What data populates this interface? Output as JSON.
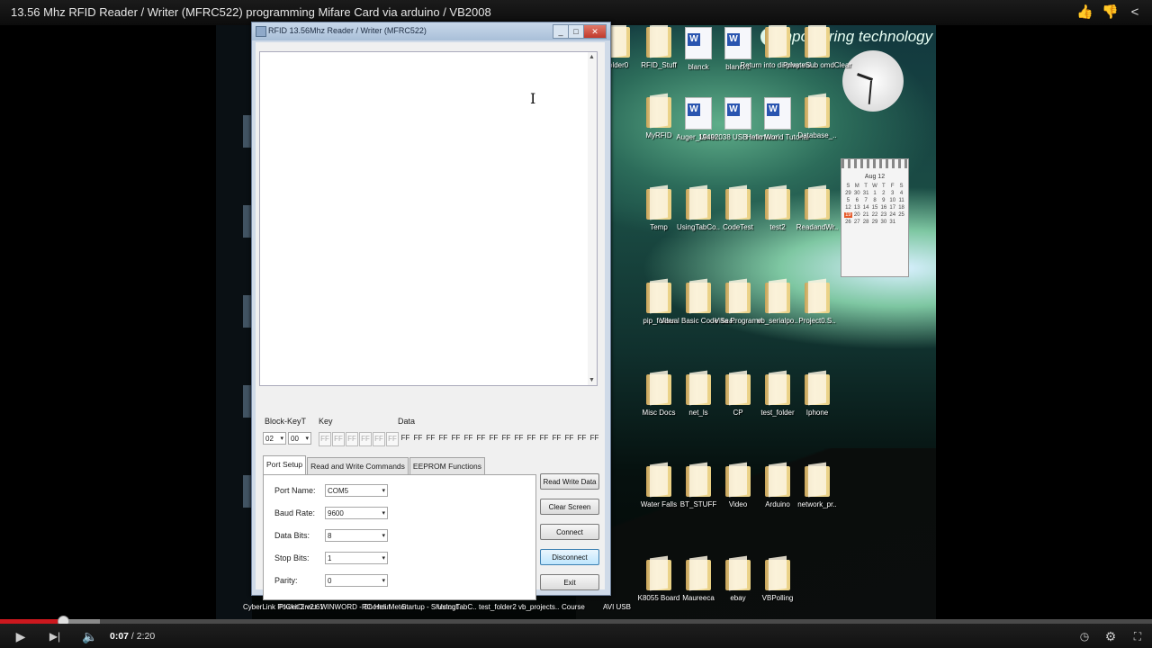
{
  "video": {
    "title": "13.56 Mhz RFID Reader / Writer (MFRC522) programming Mifare Card via arduino / VB2008",
    "current_time": "0:07",
    "duration": "2:20",
    "separator": " / ",
    "progress_fraction": 0.055,
    "buffered_fraction": 0.087
  },
  "icons": {
    "like": "thumbs-up-icon",
    "dislike": "thumbs-down-icon",
    "share": "share-icon",
    "play": "play-icon",
    "next": "next-icon",
    "volume": "volume-icon",
    "watch_later": "clock-icon",
    "settings": "gear-icon",
    "fullscreen": "fullscreen-icon"
  },
  "desktop": {
    "brand_letter": "e",
    "brand_text": "mpowering technology",
    "calendar_month": "Aug 12",
    "calendar_weekdays": [
      "S",
      "M",
      "T",
      "W",
      "T",
      "F",
      "S"
    ],
    "icons_row1": [
      "folder0",
      "RFID_Stuff",
      "blanck",
      "blanck1",
      "Return into display val..",
      "PrivateSub omdClear"
    ],
    "icons_row2": [
      "MyRFID",
      "Auger_Mixer..",
      "19492038 USB Interface",
      "Hello World Tutorial",
      "Database_.."
    ],
    "icons_row3": [
      "Temp",
      "UsingTabCo..",
      "CodeTest",
      "test2",
      "ReadandWr.."
    ],
    "icons_row4": [
      "pip_folder",
      "Visual Basic Code Sea..",
      "Visa Programs",
      "vb_serialpo..",
      "Project0.S.."
    ],
    "icons_row5": [
      "Misc Docs",
      "net_ls",
      "CP",
      "test_folder",
      "Iphone"
    ],
    "icons_row6": [
      "Water Falls",
      "BT_STUFF",
      "Video",
      "Arduino",
      "network_pr.."
    ],
    "icons_row7": [
      "K8055 Board",
      "Maureeca",
      "ebay",
      "VBPolling"
    ],
    "bottom_row": [
      "CyberLink PowerDirect",
      "PICkit 2 v2.61",
      "WINWORD - Shortcut",
      "RC Heli Meter",
      "Startup - Shortcut",
      "UsingTabC..",
      "test_folder2",
      "vb_projects..",
      "Course",
      "AVI USB"
    ]
  },
  "app": {
    "window_title": "RFID 13.56Mhz Reader / Writer (MFRC522)",
    "labels": {
      "block_key_type": "Block-KeyT",
      "key": "Key",
      "data": "Data"
    },
    "block_value": "02",
    "key_type_value": "00",
    "key_bytes": [
      "FF",
      "FF",
      "FF",
      "FF",
      "FF",
      "FF"
    ],
    "data_bytes": [
      "FF",
      "FF",
      "FF",
      "FF",
      "FF",
      "FF",
      "FF",
      "FF",
      "FF",
      "FF",
      "FF",
      "FF",
      "FF",
      "FF",
      "FF",
      "FF"
    ],
    "tabs": [
      "Port Setup",
      "Read and Write Commands",
      "EEPROM Functions"
    ],
    "port_setup": {
      "port_name_label": "Port Name:",
      "port_name_value": "COM5",
      "baud_rate_label": "Baud Rate:",
      "baud_rate_value": "9600",
      "data_bits_label": "Data Bits:",
      "data_bits_value": "8",
      "stop_bits_label": "Stop Bits:",
      "stop_bits_value": "1",
      "parity_label": "Parity:",
      "parity_value": "0"
    },
    "buttons": {
      "read_write_data": "Read Write Data",
      "clear_screen": "Clear Screen",
      "connect": "Connect",
      "disconnect": "Disconnect",
      "exit": "Exit"
    }
  }
}
